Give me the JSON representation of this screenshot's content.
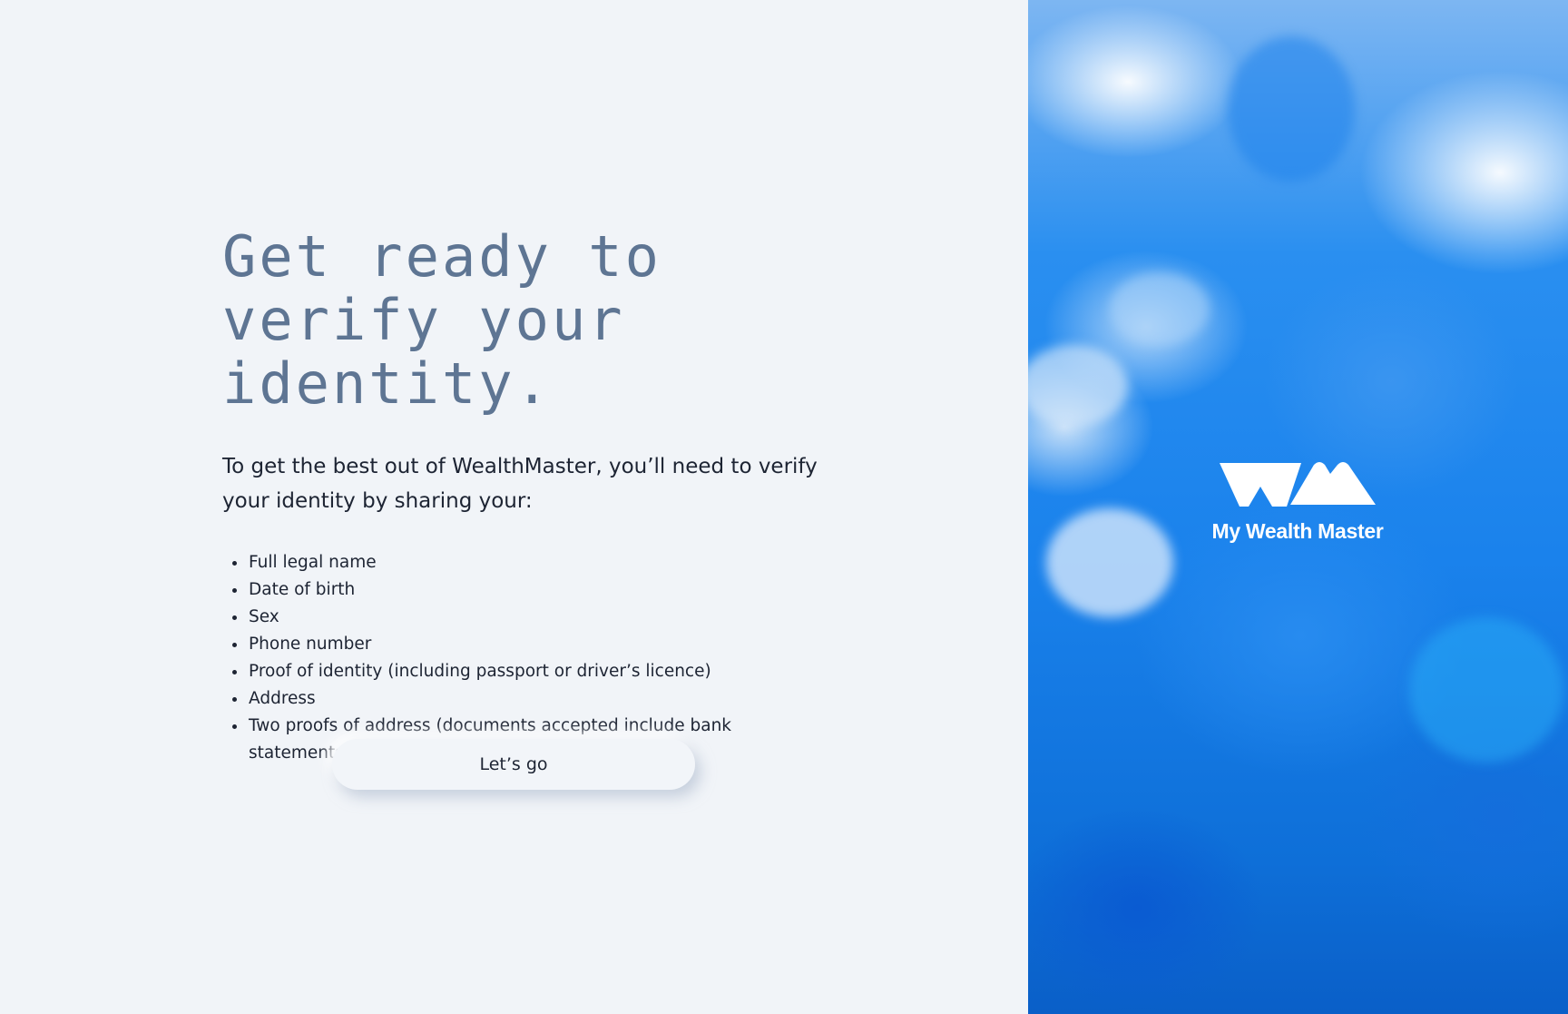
{
  "content": {
    "headline": "Get ready to verify your identity.",
    "intro": "To get the best out of WealthMaster, you’ll need to verify your identity by sharing your:",
    "requirements": [
      "Full legal name",
      "Date of birth",
      "Sex",
      "Phone number",
      "Proof of identity (including passport or driver’s licence)",
      "Address",
      "Two proofs of address (documents accepted include bank statements, utility bills)"
    ],
    "cta_label": "Let’s go"
  },
  "brand": {
    "name": "My Wealth Master",
    "logo_icon": "wm-logo-icon"
  },
  "colors": {
    "background": "#f1f4f8",
    "headline": "#5e7593",
    "body_text": "#1d2433",
    "brand_blue": "#1a82ec",
    "logo": "#ffffff"
  }
}
